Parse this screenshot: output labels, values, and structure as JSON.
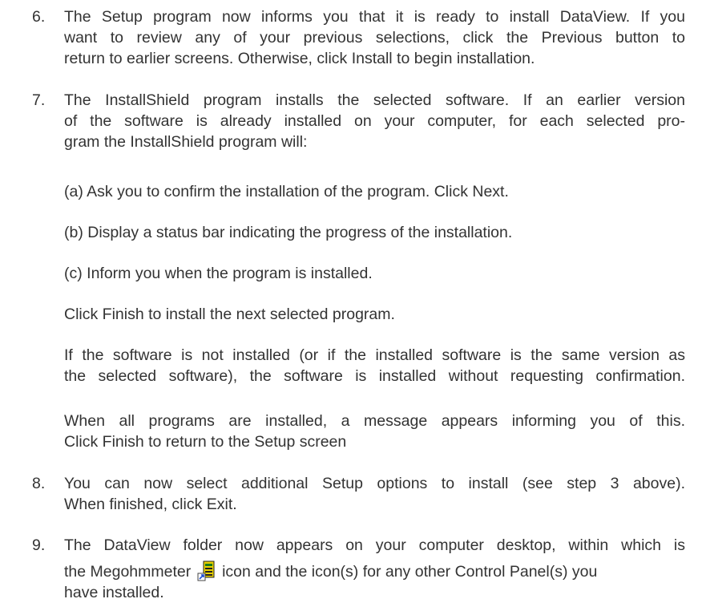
{
  "steps": [
    {
      "number": "6.",
      "lines": [
        "The Setup program now informs you that it is ready to install DataView. If you",
        "want to review any of your previous selections, click the Previous button to",
        "return to earlier screens. Otherwise, click Install to begin installation."
      ]
    },
    {
      "number": "7.",
      "lines": [
        "The InstallShield program installs the selected software. If an earlier version",
        "of the software is already installed on your computer, for each selected pro-",
        "gram the InstallShield program will:"
      ],
      "sub_items": [
        "(a) Ask you to confirm the installation of the program. Click Next.",
        "(b) Display a status bar indicating the progress of the installation.",
        "(c) Inform you when the program is installed."
      ],
      "finish_note": "Click Finish to install the next selected program.",
      "not_installed_lines": [
        "If the software is not installed (or if the installed software is the same version as",
        "the selected software), the software is installed without requesting confirmation."
      ],
      "all_installed_lines": [
        "When all programs are installed, a message appears informing you of this.",
        "Click Finish to return to the Setup screen"
      ]
    },
    {
      "number": "8.",
      "lines": [
        "You can now select additional Setup options to install (see step 3 above).",
        "When finished, click Exit."
      ]
    },
    {
      "number": "9.",
      "lines": [
        "The DataView folder now appears on your computer desktop, within which is"
      ],
      "line2_before_icon": "the Megohmmeter",
      "icon_name": "megohmmeter-icon",
      "line2_after_icon": "icon and the icon(s) for any other Control Panel(s) you",
      "line3": "have installed."
    }
  ]
}
